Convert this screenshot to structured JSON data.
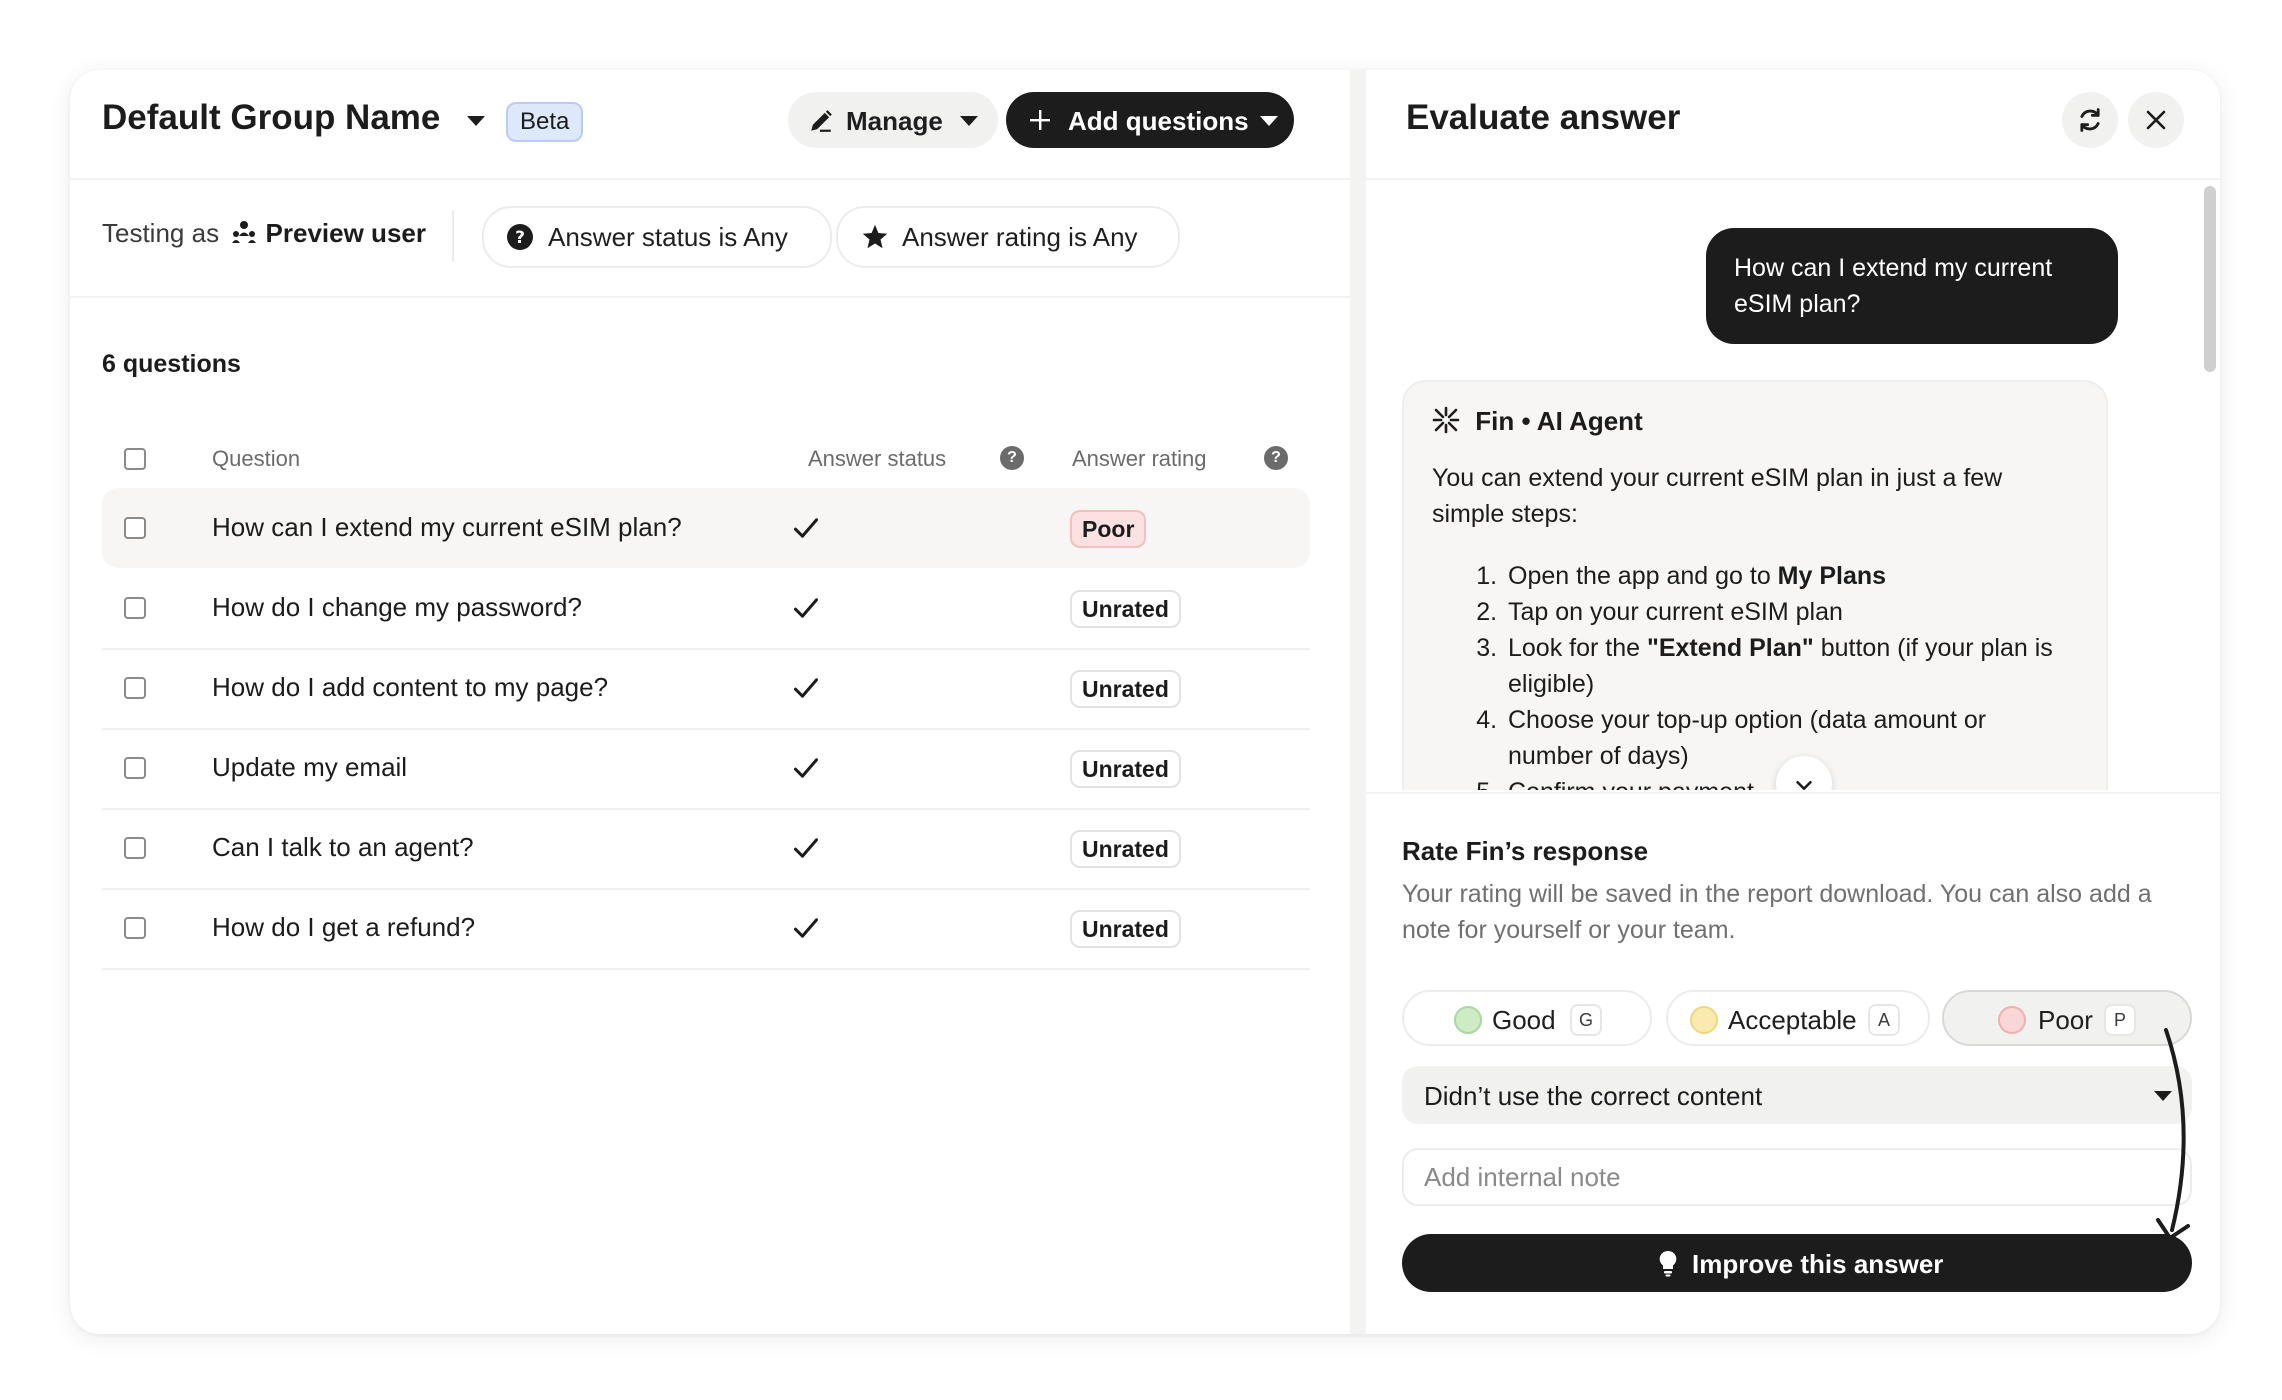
{
  "header": {
    "title": "Default Group Name",
    "badge": "Beta",
    "manage_label": "Manage",
    "add_questions_label": "Add questions"
  },
  "filters": {
    "testing_prefix": "Testing as",
    "preview_user": "Preview user",
    "answer_status_chip": "Answer status is Any",
    "answer_rating_chip": "Answer rating is Any"
  },
  "table": {
    "count_label": "6 questions",
    "columns": [
      "Question",
      "Answer status",
      "Answer rating"
    ],
    "rows": [
      {
        "question": "How can I extend my current eSIM plan?",
        "rating": "Poor"
      },
      {
        "question": "How do I change my password?",
        "rating": "Unrated"
      },
      {
        "question": "How do I add content to my page?",
        "rating": "Unrated"
      },
      {
        "question": "Update my email",
        "rating": "Unrated"
      },
      {
        "question": "Can I talk to an agent?",
        "rating": "Unrated"
      },
      {
        "question": "How do I get a refund?",
        "rating": "Unrated"
      }
    ]
  },
  "evaluate": {
    "title": "Evaluate answer",
    "user_message": "How can I extend my current eSIM plan?",
    "agent_name": "Fin • AI Agent",
    "agent_intro": "You can extend your current eSIM plan in just a few simple steps:",
    "steps": [
      {
        "pre": "Open the app and go to ",
        "bold": "My Plans",
        "post": ""
      },
      {
        "pre": "Tap on your current eSIM plan",
        "bold": "",
        "post": ""
      },
      {
        "pre": "Look for the ",
        "bold": "\"Extend Plan\"",
        "post": " button (if your plan is eligible)"
      },
      {
        "pre": "Choose your top-up option (data amount or number of days)",
        "bold": "",
        "post": ""
      },
      {
        "pre": "Confirm your payment",
        "bold": "",
        "post": ""
      }
    ]
  },
  "rating": {
    "title": "Rate Fin’s response",
    "description": "Your rating will be saved in the report download. You can also add a note for yourself or your team.",
    "options": [
      {
        "label": "Good",
        "key": "G",
        "color": "#cdebc5"
      },
      {
        "label": "Acceptable",
        "key": "A",
        "color": "#fbeab0"
      },
      {
        "label": "Poor",
        "key": "P",
        "color": "#fbd6d6"
      }
    ],
    "selected": "Poor",
    "reason": "Didn’t use the correct content",
    "note_placeholder": "Add internal note",
    "improve_label": "Improve this answer"
  }
}
